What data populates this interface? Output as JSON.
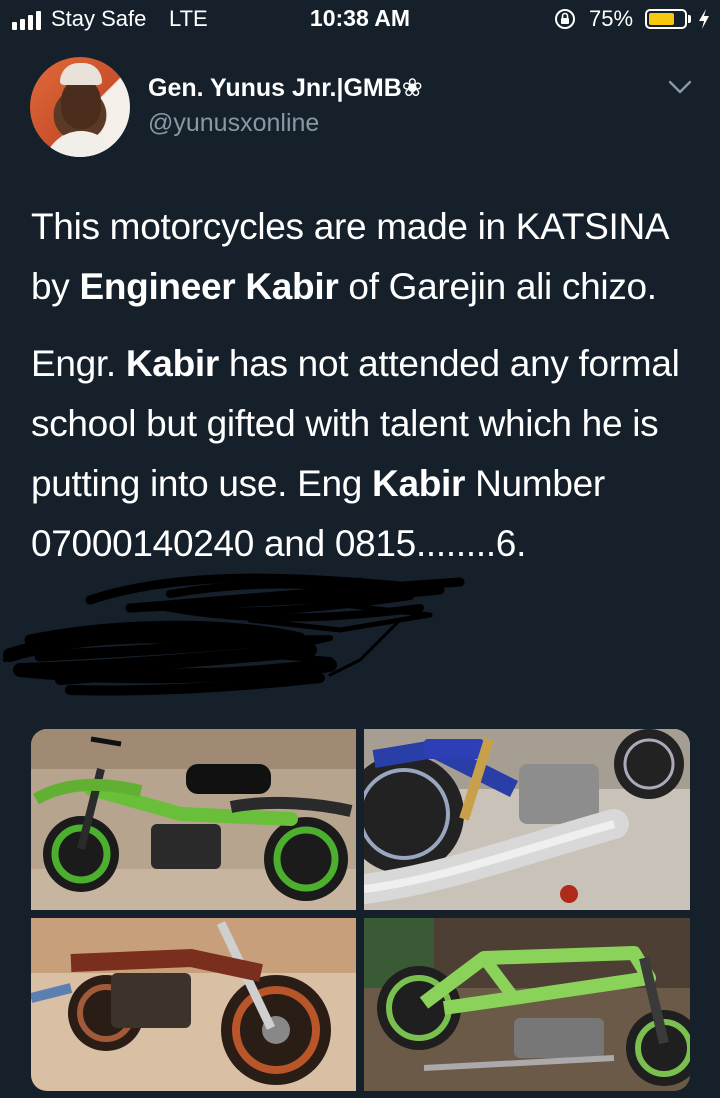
{
  "status_bar": {
    "carrier": "Stay Safe",
    "network": "LTE",
    "time": "10:38 AM",
    "battery_percent": "75%",
    "battery_level": 0.75,
    "battery_color": "#f6c90e",
    "icons": [
      "signal-icon",
      "orientation-lock-icon",
      "battery-icon",
      "charging-bolt-icon"
    ]
  },
  "tweet": {
    "author": {
      "display_name": "Gen. Yunus Jnr.|GMB❀",
      "handle": "@yunusxonline"
    },
    "paragraph_1": {
      "part_1": "This motorcycles are made in KATSINA by ",
      "bold_1": "Engineer Kabir",
      "part_2": " of Garejin ali chizo."
    },
    "paragraph_2": {
      "part_1": "Engr. ",
      "bold_1": "Kabir",
      "part_2": " has not attended any formal school but gifted with talent which he is putting into use. Eng ",
      "bold_2": "Kabir",
      "part_3": " Number 07000140240 and 0815........6."
    },
    "media": [
      {
        "label": "green motorcycle with black seat"
      },
      {
        "label": "blue motorcycle engine and chrome exhaust"
      },
      {
        "label": "orange motorcycle with disc brake"
      },
      {
        "label": "green motorcycle frame"
      }
    ]
  },
  "colors": {
    "background": "#15202b",
    "text": "#ffffff",
    "secondary_text": "#8899a6"
  }
}
